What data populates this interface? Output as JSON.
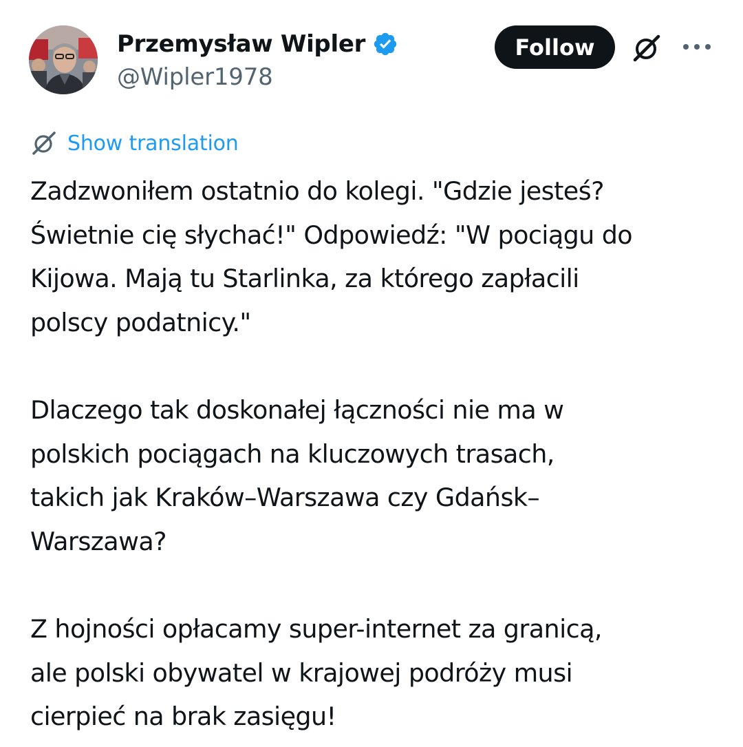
{
  "author": {
    "display_name": "Przemysław Wipler",
    "handle": "@Wipler1978",
    "verified": true
  },
  "actions": {
    "follow_label": "Follow"
  },
  "icons": {
    "verified": "verified-badge-icon",
    "grok": "grok-icon",
    "more": "more-options-icon",
    "translate": "translate-icon"
  },
  "translation": {
    "label": "Show translation"
  },
  "tweet": {
    "paragraphs": [
      {
        "lines": [
          "Zadzwoniłem ostatnio do kolegi. \"Gdzie jesteś?",
          "Świetnie cię słychać!\" Odpowiedź: \"W pociągu do",
          "Kijowa. Mają tu Starlinka, za którego zapłacili",
          "polscy podatnicy.\""
        ]
      },
      {
        "lines": [
          "Dlaczego tak doskonałej łączności nie ma w",
          "polskich pociągach na kluczowych trasach,",
          "takich jak Kraków–Warszawa czy Gdańsk–",
          "Warszawa?"
        ]
      },
      {
        "lines": [
          "Z hojności opłacamy super-internet za granicą,",
          "ale polski obywatel w krajowej podróży musi",
          "cierpieć na brak zasięgu!"
        ]
      }
    ]
  },
  "colors": {
    "text": "#0f1419",
    "secondary": "#536471",
    "link": "#1d9bf0",
    "verified": "#1d9bf0",
    "follow_bg": "#0f1419",
    "follow_text": "#ffffff"
  }
}
